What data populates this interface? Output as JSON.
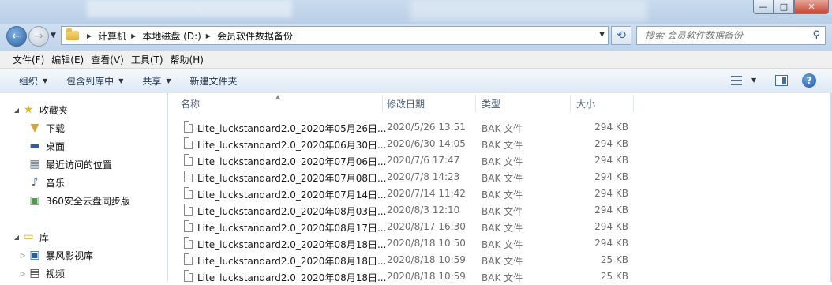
{
  "window": {
    "min_glyph": "—",
    "max_glyph": "□",
    "close_glyph": "✕"
  },
  "nav": {
    "back_glyph": "←",
    "forward_glyph": "→"
  },
  "address": {
    "crumbs": [
      "计算机",
      "本地磁盘 (D:)",
      "会员软件数据备份"
    ]
  },
  "search": {
    "placeholder": "搜索 会员软件数据备份"
  },
  "menu": [
    "文件(F)",
    "编辑(E)",
    "查看(V)",
    "工具(T)",
    "帮助(H)"
  ],
  "toolbar": {
    "organize": "组织",
    "include_in_library": "包含到库中",
    "share": "共享",
    "new_folder": "新建文件夹",
    "help_glyph": "?"
  },
  "sidebar": {
    "favorites": "收藏夹",
    "favorite_items": [
      "下载",
      "桌面",
      "最近访问的位置",
      "音乐",
      "360安全云盘同步版"
    ],
    "libraries": "库",
    "library_items": [
      "暴风影视库",
      "视频"
    ]
  },
  "columns": {
    "name": "名称",
    "modified": "修改日期",
    "type": "类型",
    "size": "大小"
  },
  "files": [
    {
      "name": "Lite_luckstandard2.0_2020年05月26日...",
      "modified": "2020/5/26 13:51",
      "type": "BAK 文件",
      "size": "294 KB"
    },
    {
      "name": "Lite_luckstandard2.0_2020年06月30日...",
      "modified": "2020/6/30 14:05",
      "type": "BAK 文件",
      "size": "294 KB"
    },
    {
      "name": "Lite_luckstandard2.0_2020年07月06日...",
      "modified": "2020/7/6 17:47",
      "type": "BAK 文件",
      "size": "294 KB"
    },
    {
      "name": "Lite_luckstandard2.0_2020年07月08日...",
      "modified": "2020/7/8 14:23",
      "type": "BAK 文件",
      "size": "294 KB"
    },
    {
      "name": "Lite_luckstandard2.0_2020年07月14日...",
      "modified": "2020/7/14 11:42",
      "type": "BAK 文件",
      "size": "294 KB"
    },
    {
      "name": "Lite_luckstandard2.0_2020年08月03日...",
      "modified": "2020/8/3 12:10",
      "type": "BAK 文件",
      "size": "294 KB"
    },
    {
      "name": "Lite_luckstandard2.0_2020年08月17日...",
      "modified": "2020/8/17 16:30",
      "type": "BAK 文件",
      "size": "294 KB"
    },
    {
      "name": "Lite_luckstandard2.0_2020年08月18日...",
      "modified": "2020/8/18 10:50",
      "type": "BAK 文件",
      "size": "294 KB"
    },
    {
      "name": "Lite_luckstandard2.0_2020年08月18日...",
      "modified": "2020/8/18 10:59",
      "type": "BAK 文件",
      "size": "25 KB"
    },
    {
      "name": "Lite_luckstandard2.0_2020年08月18日...",
      "modified": "2020/8/18 10:59",
      "type": "BAK 文件",
      "size": "25 KB"
    }
  ]
}
